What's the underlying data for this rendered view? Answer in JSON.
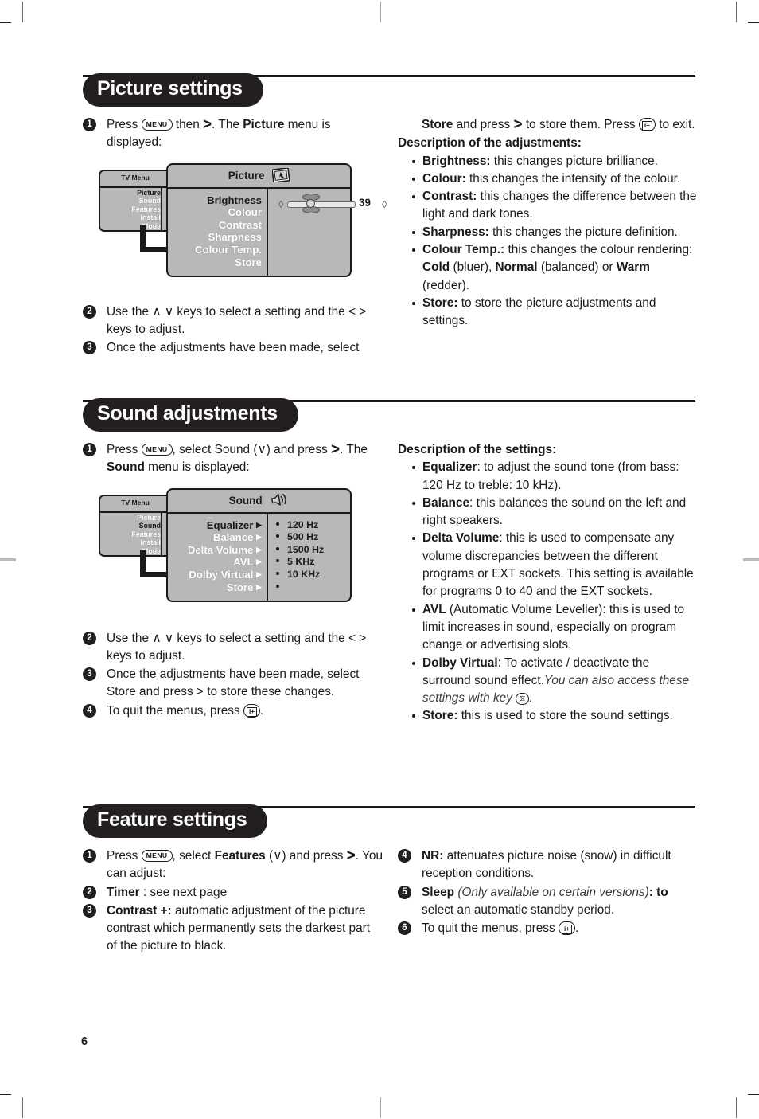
{
  "page": {
    "number": "6"
  },
  "sections": [
    {
      "heading": "Picture settings",
      "steps": [
        {
          "num": "1",
          "text_a": "Press ",
          "key": "MENU",
          "text_b": " then ",
          "glyph": ">",
          "text_c": ". The ",
          "bold": "Picture",
          "text_d": " menu is displayed:"
        },
        {
          "num": "2",
          "text": "Use the ∧ ∨ keys to select a setting and the < > keys to adjust."
        },
        {
          "num": "3",
          "text": "Once the adjustments have been made, select"
        }
      ],
      "osd": {
        "left_title": "TV Menu",
        "left_items": [
          "Picture",
          "Sound",
          "Features",
          "Install",
          "Mode"
        ],
        "left_selected": "Picture",
        "main_title": "Picture",
        "main_icon": "picture-screen-icon",
        "names": [
          "Brightness",
          "Colour",
          "Contrast",
          "Sharpness",
          "Colour Temp.",
          "Store"
        ],
        "name_selected": "Brightness",
        "slider_value": "39"
      },
      "right": {
        "cont_a": "Store",
        "cont_b": " and press ",
        "cont_glyph": ">",
        "cont_c": " to store them. Press ",
        "cont_key": "i+",
        "cont_d": " to exit.",
        "desc_title": "Description of the adjustments:",
        "items": [
          {
            "bold": "Brightness:",
            "text": " this changes picture brilliance."
          },
          {
            "bold": "Colour:",
            "text": " this changes the intensity of the colour."
          },
          {
            "bold": "Contrast:",
            "text": " this changes the difference between the light and dark tones."
          },
          {
            "bold": "Sharpness:",
            "text": " this changes the picture definition."
          },
          {
            "bold": "Colour Temp.:",
            "text": " this changes the colour rendering: ",
            "b2": "Cold",
            "t2": " (bluer), ",
            "b3": "Normal",
            "t3": " (balanced) or ",
            "b4": "Warm",
            "t4": " (redder)."
          },
          {
            "bold": "Store:",
            "text": " to store the picture adjustments and settings."
          }
        ]
      }
    },
    {
      "heading": "Sound adjustments",
      "steps": [
        {
          "num": "1",
          "text_a": "Press ",
          "key": "MENU",
          "text_b": ", select Sound (∨) and press ",
          "glyph": ">",
          "text_c": ". The ",
          "bold": "Sound",
          "text_d": " menu is displayed:"
        },
        {
          "num": "2",
          "text": "Use the ∧ ∨ keys to select a setting and the < > keys to adjust."
        },
        {
          "num": "3",
          "text": "Once the adjustments have been made, select Store and press > to store these changes."
        },
        {
          "num": "4",
          "text_a": "To quit the menus, press ",
          "key": "i+",
          "text_b": "."
        }
      ],
      "osd": {
        "left_title": "TV Menu",
        "left_items": [
          "Picture",
          "Sound",
          "Features",
          "Install",
          "Mode"
        ],
        "left_selected": "Sound",
        "main_title": "Sound",
        "main_icon": "speaker-icon",
        "names": [
          "Equalizer",
          "Balance",
          "Delta Volume",
          "AVL",
          "Dolby Virtual",
          "Store"
        ],
        "name_selected": "Equalizer",
        "values": [
          "120 Hz",
          "500 Hz",
          "1500 Hz",
          "5 KHz",
          "10 KHz",
          ""
        ]
      },
      "right": {
        "desc_title": "Description of the settings:",
        "items": [
          {
            "bold": "Equalizer",
            "text": ": to adjust the sound tone (from bass: 120 Hz to treble: 10 kHz)."
          },
          {
            "bold": "Balance",
            "text": ": this balances the sound on the left and right speakers."
          },
          {
            "bold": "Delta Volume",
            "text": ": this is used to compensate any volume discrepancies between the different programs or EXT sockets. This setting is available for programs 0 to 40 and the EXT sockets."
          },
          {
            "bold": "AVL",
            "text": " (Automatic Volume Leveller): this is used to limit increases in sound, especially on program change or advertising slots."
          },
          {
            "bold": "Dolby Virtual",
            "text": ": To activate / deactivate the surround sound effect.",
            "italic": "You can also access these settings with key ",
            "key": "dolby-icon",
            "italic_end": "."
          },
          {
            "bold": "Store:",
            "text": " this is used to store the sound settings."
          }
        ]
      }
    },
    {
      "heading": "Feature settings",
      "steps_left": [
        {
          "num": "1",
          "text_a": "Press ",
          "key": "MENU",
          "text_b": ", select ",
          "bold": "Features",
          "text_c": " (∨) and press ",
          "glyph": ">",
          "text_d": ". You can adjust:"
        },
        {
          "num": "2",
          "bold": "Timer",
          "text": " : see next page"
        },
        {
          "num": "3",
          "bold": "Contrast +:",
          "text": " automatic adjustment of the picture contrast which permanently sets the darkest part of the picture to black."
        }
      ],
      "steps_right": [
        {
          "num": "4",
          "bold": "NR:",
          "text": " attenuates picture noise (snow) in difficult reception conditions."
        },
        {
          "num": "5",
          "bold": "Sleep",
          "italic": " (Only available on certain versions)",
          "bold2": ": to",
          "text": " select an automatic standby period."
        },
        {
          "num": "6",
          "text_a": "To quit the menus, press ",
          "key": "i+",
          "text_b": "."
        }
      ]
    }
  ]
}
